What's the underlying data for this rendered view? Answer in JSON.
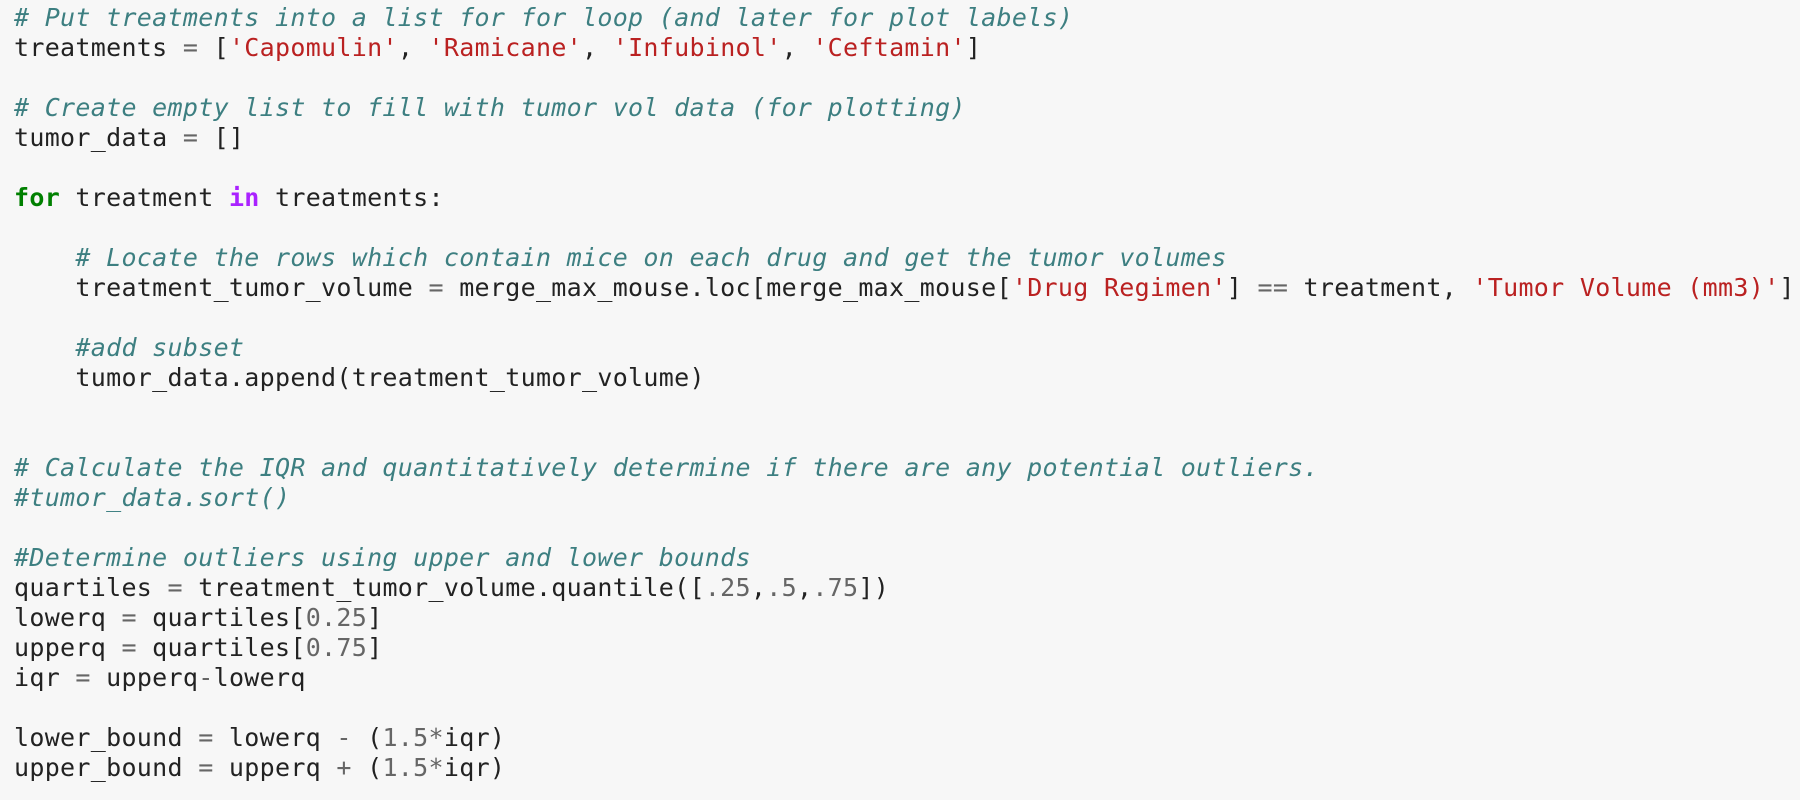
{
  "code_lines": [
    [
      {
        "t": "cm",
        "v": "# Put treatments into a list for for loop (and later for plot labels)"
      }
    ],
    [
      {
        "t": "",
        "v": "treatments "
      },
      {
        "t": "op",
        "v": "="
      },
      {
        "t": "",
        "v": " ["
      },
      {
        "t": "str",
        "v": "'Capomulin'"
      },
      {
        "t": "",
        "v": ", "
      },
      {
        "t": "str",
        "v": "'Ramicane'"
      },
      {
        "t": "",
        "v": ", "
      },
      {
        "t": "str",
        "v": "'Infubinol'"
      },
      {
        "t": "",
        "v": ", "
      },
      {
        "t": "str",
        "v": "'Ceftamin'"
      },
      {
        "t": "",
        "v": "]"
      }
    ],
    [],
    [
      {
        "t": "cm",
        "v": "# Create empty list to fill with tumor vol data (for plotting)"
      }
    ],
    [
      {
        "t": "",
        "v": "tumor_data "
      },
      {
        "t": "op",
        "v": "="
      },
      {
        "t": "",
        "v": " []"
      }
    ],
    [],
    [
      {
        "t": "kw",
        "v": "for"
      },
      {
        "t": "",
        "v": " treatment "
      },
      {
        "t": "op-kw",
        "v": "in"
      },
      {
        "t": "",
        "v": " treatments:"
      }
    ],
    [],
    [
      {
        "t": "",
        "v": "    "
      },
      {
        "t": "cm",
        "v": "# Locate the rows which contain mice on each drug and get the tumor volumes"
      }
    ],
    [
      {
        "t": "",
        "v": "    treatment_tumor_volume "
      },
      {
        "t": "op",
        "v": "="
      },
      {
        "t": "",
        "v": " merge_max_mouse.loc[merge_max_mouse["
      },
      {
        "t": "str",
        "v": "'Drug Regimen'"
      },
      {
        "t": "",
        "v": "] "
      },
      {
        "t": "op",
        "v": "=="
      },
      {
        "t": "",
        "v": " treatment, "
      },
      {
        "t": "str",
        "v": "'Tumor Volume (mm3)'"
      },
      {
        "t": "",
        "v": "]"
      }
    ],
    [],
    [
      {
        "t": "",
        "v": "    "
      },
      {
        "t": "cm",
        "v": "#add subset"
      }
    ],
    [
      {
        "t": "",
        "v": "    tumor_data.append(treatment_tumor_volume)"
      }
    ],
    [],
    [],
    [
      {
        "t": "cm",
        "v": "# Calculate the IQR and quantitatively determine if there are any potential outliers."
      }
    ],
    [
      {
        "t": "cm",
        "v": "#tumor_data.sort()"
      }
    ],
    [],
    [
      {
        "t": "cm",
        "v": "#Determine outliers using upper and lower bounds"
      }
    ],
    [
      {
        "t": "",
        "v": "quartiles "
      },
      {
        "t": "op",
        "v": "="
      },
      {
        "t": "",
        "v": " treatment_tumor_volume.quantile(["
      },
      {
        "t": "num",
        "v": ".25"
      },
      {
        "t": "",
        "v": ","
      },
      {
        "t": "num",
        "v": ".5"
      },
      {
        "t": "",
        "v": ","
      },
      {
        "t": "num",
        "v": ".75"
      },
      {
        "t": "",
        "v": "])"
      }
    ],
    [
      {
        "t": "",
        "v": "lowerq "
      },
      {
        "t": "op",
        "v": "="
      },
      {
        "t": "",
        "v": " quartiles["
      },
      {
        "t": "num",
        "v": "0.25"
      },
      {
        "t": "",
        "v": "]"
      }
    ],
    [
      {
        "t": "",
        "v": "upperq "
      },
      {
        "t": "op",
        "v": "="
      },
      {
        "t": "",
        "v": " quartiles["
      },
      {
        "t": "num",
        "v": "0.75"
      },
      {
        "t": "",
        "v": "]"
      }
    ],
    [
      {
        "t": "",
        "v": "iqr "
      },
      {
        "t": "op",
        "v": "="
      },
      {
        "t": "",
        "v": " upperq"
      },
      {
        "t": "op",
        "v": "-"
      },
      {
        "t": "",
        "v": "lowerq"
      }
    ],
    [],
    [
      {
        "t": "",
        "v": "lower_bound "
      },
      {
        "t": "op",
        "v": "="
      },
      {
        "t": "",
        "v": " lowerq "
      },
      {
        "t": "op",
        "v": "-"
      },
      {
        "t": "",
        "v": " ("
      },
      {
        "t": "num",
        "v": "1.5"
      },
      {
        "t": "op",
        "v": "*"
      },
      {
        "t": "",
        "v": "iqr)"
      }
    ],
    [
      {
        "t": "",
        "v": "upper_bound "
      },
      {
        "t": "op",
        "v": "="
      },
      {
        "t": "",
        "v": " upperq "
      },
      {
        "t": "op",
        "v": "+"
      },
      {
        "t": "",
        "v": " ("
      },
      {
        "t": "num",
        "v": "1.5"
      },
      {
        "t": "op",
        "v": "*"
      },
      {
        "t": "",
        "v": "iqr)"
      }
    ]
  ],
  "colors": {
    "background": "#f7f7f7",
    "comment": "#3d7f81",
    "keyword": "#008000",
    "operator_keyword": "#aa22ff",
    "string": "#ba2121",
    "number": "#666666"
  }
}
